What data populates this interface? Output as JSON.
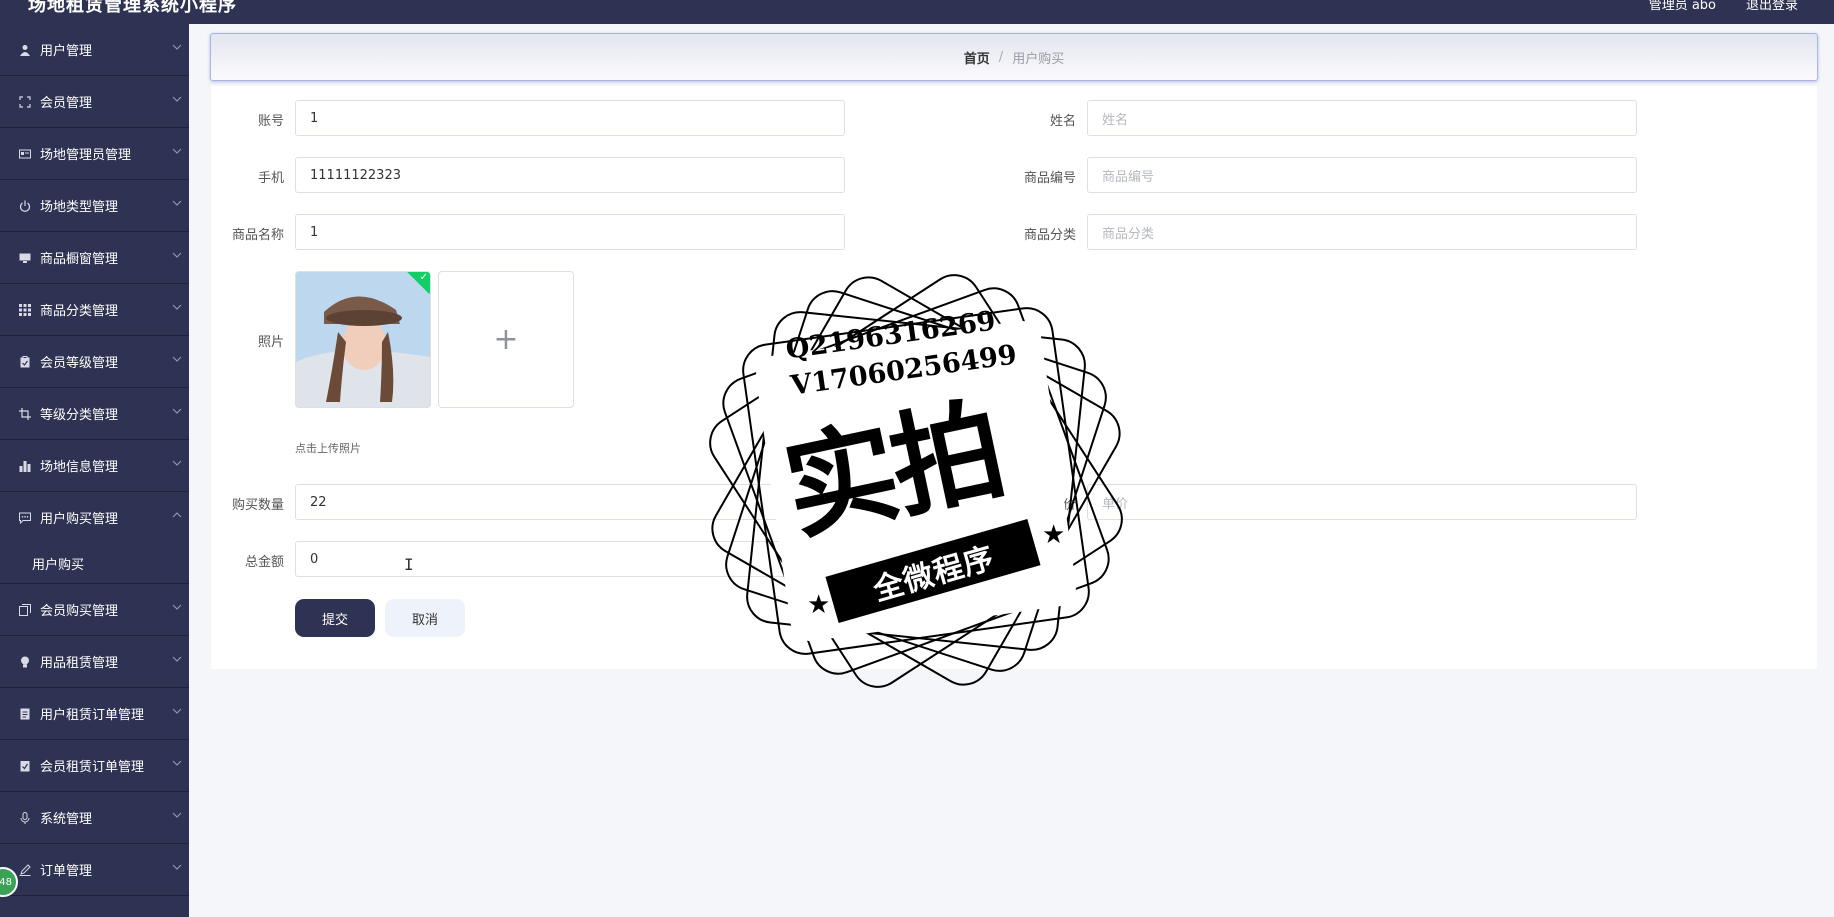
{
  "app": {
    "title": "场地租赁管理系统小程序",
    "user_label": "管理员 abo",
    "logout_label": "退出登录"
  },
  "sidebar": {
    "items": [
      {
        "label": "用户管理",
        "icon": "user-icon"
      },
      {
        "label": "会员管理",
        "icon": "expand-icon"
      },
      {
        "label": "场地管理员管理",
        "icon": "id-card-icon"
      },
      {
        "label": "场地类型管理",
        "icon": "power-icon"
      },
      {
        "label": "商品橱窗管理",
        "icon": "monitor-icon"
      },
      {
        "label": "商品分类管理",
        "icon": "grid-icon"
      },
      {
        "label": "会员等级管理",
        "icon": "clipboard-icon"
      },
      {
        "label": "等级分类管理",
        "icon": "crop-icon"
      },
      {
        "label": "场地信息管理",
        "icon": "bar-chart-icon"
      },
      {
        "label": "用户购买管理",
        "icon": "chat-icon",
        "expanded": true,
        "children": [
          {
            "label": "用户购买"
          }
        ]
      },
      {
        "label": "会员购买管理",
        "icon": "copy-icon"
      },
      {
        "label": "用品租赁管理",
        "icon": "bulb-icon"
      },
      {
        "label": "用户租赁订单管理",
        "icon": "document-icon"
      },
      {
        "label": "会员租赁订单管理",
        "icon": "checklist-icon"
      },
      {
        "label": "系统管理",
        "icon": "microphone-icon"
      },
      {
        "label": "订单管理",
        "icon": "edit-icon"
      }
    ],
    "badge": "48"
  },
  "breadcrumb": {
    "home": "首页",
    "separator": "/",
    "current": "用户购买"
  },
  "form": {
    "account": {
      "label": "账号",
      "value": "1"
    },
    "name": {
      "label": "姓名",
      "placeholder": "姓名"
    },
    "phone": {
      "label": "手机",
      "value": "11111122323"
    },
    "product_code": {
      "label": "商品编号",
      "placeholder": "商品编号"
    },
    "product_name": {
      "label": "商品名称",
      "value": "1"
    },
    "product_category": {
      "label": "商品分类",
      "placeholder": "商品分类"
    },
    "photo": {
      "label": "照片",
      "hint": "点击上传照片",
      "add_symbol": "+"
    },
    "quantity": {
      "label": "购买数量",
      "value": "22"
    },
    "unit_price": {
      "label": "单价",
      "placeholder": "单价"
    },
    "total": {
      "label": "总金额",
      "value": "0"
    },
    "submit_label": "提交",
    "cancel_label": "取消"
  },
  "watermark": {
    "qq": "Q2196316269",
    "vx": "V17060256499",
    "main": "实拍",
    "banner": "全微程序"
  }
}
